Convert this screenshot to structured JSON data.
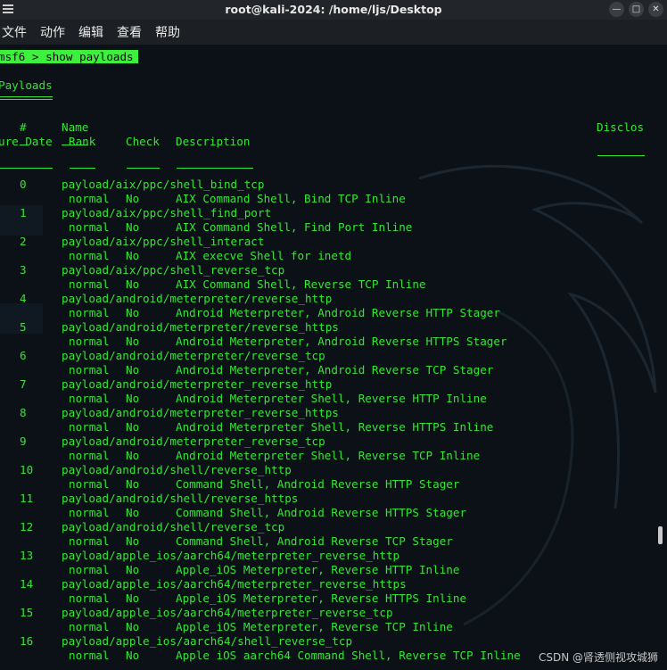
{
  "window": {
    "title": "root@kali-2024: /home/ljs/Desktop"
  },
  "menu": [
    "文件",
    "动作",
    "编辑",
    "查看",
    "帮助"
  ],
  "terminal": {
    "prompt": "msf6 > show payloads",
    "section_title": "Payloads",
    "header": {
      "hash": "#",
      "name": "Name",
      "disclosure": "Disclos",
      "disclosure_cont": "ure Date",
      "rank": "Rank",
      "check": "Check",
      "description": "Description"
    },
    "payloads": [
      {
        "num": "0",
        "name": "payload/aix/ppc/shell_bind_tcp",
        "rank": "normal",
        "check": "No",
        "description": "AIX Command Shell, Bind TCP Inline"
      },
      {
        "num": "1",
        "name": "payload/aix/ppc/shell_find_port",
        "rank": "normal",
        "check": "No",
        "description": "AIX Command Shell, Find Port Inline"
      },
      {
        "num": "2",
        "name": "payload/aix/ppc/shell_interact",
        "rank": "normal",
        "check": "No",
        "description": "AIX execve Shell for inetd"
      },
      {
        "num": "3",
        "name": "payload/aix/ppc/shell_reverse_tcp",
        "rank": "normal",
        "check": "No",
        "description": "AIX Command Shell, Reverse TCP Inline"
      },
      {
        "num": "4",
        "name": "payload/android/meterpreter/reverse_http",
        "rank": "normal",
        "check": "No",
        "description": "Android Meterpreter, Android Reverse HTTP Stager"
      },
      {
        "num": "5",
        "name": "payload/android/meterpreter/reverse_https",
        "rank": "normal",
        "check": "No",
        "description": "Android Meterpreter, Android Reverse HTTPS Stager"
      },
      {
        "num": "6",
        "name": "payload/android/meterpreter/reverse_tcp",
        "rank": "normal",
        "check": "No",
        "description": "Android Meterpreter, Android Reverse TCP Stager"
      },
      {
        "num": "7",
        "name": "payload/android/meterpreter_reverse_http",
        "rank": "normal",
        "check": "No",
        "description": "Android Meterpreter Shell, Reverse HTTP Inline"
      },
      {
        "num": "8",
        "name": "payload/android/meterpreter_reverse_https",
        "rank": "normal",
        "check": "No",
        "description": "Android Meterpreter Shell, Reverse HTTPS Inline"
      },
      {
        "num": "9",
        "name": "payload/android/meterpreter_reverse_tcp",
        "rank": "normal",
        "check": "No",
        "description": "Android Meterpreter Shell, Reverse TCP Inline"
      },
      {
        "num": "10",
        "name": "payload/android/shell/reverse_http",
        "rank": "normal",
        "check": "No",
        "description": "Command Shell, Android Reverse HTTP Stager"
      },
      {
        "num": "11",
        "name": "payload/android/shell/reverse_https",
        "rank": "normal",
        "check": "No",
        "description": "Command Shell, Android Reverse HTTPS Stager"
      },
      {
        "num": "12",
        "name": "payload/android/shell/reverse_tcp",
        "rank": "normal",
        "check": "No",
        "description": "Command Shell, Android Reverse TCP Stager"
      },
      {
        "num": "13",
        "name": "payload/apple_ios/aarch64/meterpreter_reverse_http",
        "rank": "normal",
        "check": "No",
        "description": "Apple_iOS Meterpreter, Reverse HTTP Inline"
      },
      {
        "num": "14",
        "name": "payload/apple_ios/aarch64/meterpreter_reverse_https",
        "rank": "normal",
        "check": "No",
        "description": "Apple_iOS Meterpreter, Reverse HTTPS Inline"
      },
      {
        "num": "15",
        "name": "payload/apple_ios/aarch64/meterpreter_reverse_tcp",
        "rank": "normal",
        "check": "No",
        "description": "Apple_iOS Meterpreter, Reverse TCP Inline"
      },
      {
        "num": "16",
        "name": "payload/apple_ios/aarch64/shell_reverse_tcp",
        "rank": "normal",
        "check": "No",
        "description": "Apple iOS aarch64 Command Shell, Reverse TCP Inline"
      }
    ]
  },
  "watermark": "CSDN @肾透侧视攻城狮",
  "colors": {
    "terminal_text": "#33e533",
    "terminal_bg": "#0c1117",
    "prompt_bg": "#3cf03c"
  }
}
